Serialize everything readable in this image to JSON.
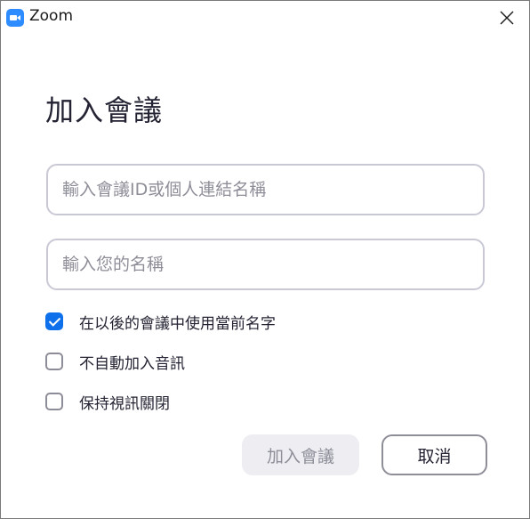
{
  "window": {
    "title": "Zoom"
  },
  "dialog": {
    "heading": "加入會議",
    "meeting_id_placeholder": "輸入會議ID或個人連結名稱",
    "meeting_id_value": "",
    "name_placeholder": "輸入您的名稱",
    "name_value": "",
    "options": [
      {
        "label": "在以後的會議中使用當前名字",
        "checked": true
      },
      {
        "label": "不自動加入音訊",
        "checked": false
      },
      {
        "label": "保持視訊關閉",
        "checked": false
      }
    ],
    "join_button": "加入會議",
    "join_button_enabled": false,
    "cancel_button": "取消"
  },
  "colors": {
    "brand": "#2d8cff",
    "checkbox_checked": "#0e71eb",
    "disabled_button_bg": "#ededf2"
  },
  "icons": {
    "app": "zoom-camera-icon",
    "close": "close-icon",
    "check": "check-icon"
  }
}
